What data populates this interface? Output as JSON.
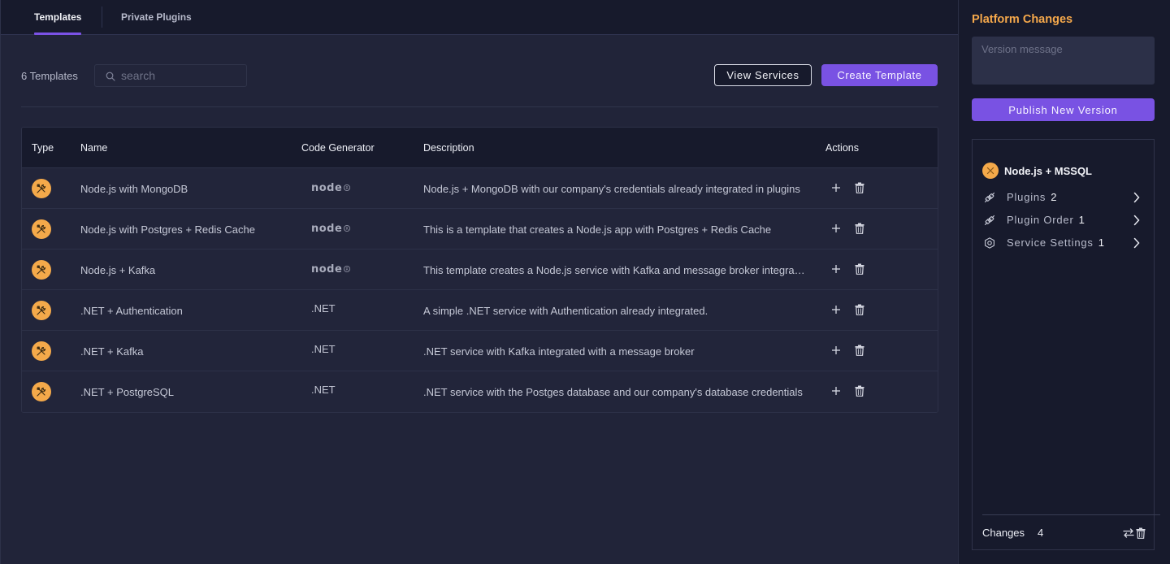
{
  "tabs": [
    {
      "label": "Templates",
      "active": true
    },
    {
      "label": "Private Plugins",
      "active": false
    }
  ],
  "toolbar": {
    "count_label": "6 Templates",
    "search_placeholder": "search",
    "search_value": "",
    "view_services_label": "View Services",
    "create_template_label": "Create Template"
  },
  "table": {
    "columns": [
      "Type",
      "Name",
      "Code Generator",
      "Description",
      "Actions"
    ],
    "rows": [
      {
        "type_icon": "tools-icon",
        "name": "Node.js with MongoDB",
        "generator": "node",
        "generator_label": "node",
        "description": "Node.js + MongoDB with our company's credentials already integrated in plugins"
      },
      {
        "type_icon": "tools-icon",
        "name": "Node.js with Postgres + Redis Cache",
        "generator": "node",
        "generator_label": "node",
        "description": "This is a template that creates a Node.js app with Postgres + Redis Cache"
      },
      {
        "type_icon": "tools-icon",
        "name": "Node.js + Kafka",
        "generator": "node",
        "generator_label": "node",
        "description": "This template creates a Node.js service with Kafka and message broker integration"
      },
      {
        "type_icon": "tools-icon",
        "name": ".NET + Authentication",
        "generator": "dotnet",
        "generator_label": ".NET",
        "description": "A simple .NET service with Authentication already integrated."
      },
      {
        "type_icon": "tools-icon",
        "name": ".NET + Kafka",
        "generator": "dotnet",
        "generator_label": ".NET",
        "description": ".NET service with Kafka integrated with a message broker"
      },
      {
        "type_icon": "tools-icon",
        "name": ".NET + PostgreSQL",
        "generator": "dotnet",
        "generator_label": ".NET",
        "description": ".NET service with the Postges database and our company's database credentials"
      }
    ]
  },
  "sidebar": {
    "title": "Platform Changes",
    "version_placeholder": "Version message",
    "version_value": "",
    "publish_label": "Publish New Version",
    "service": {
      "name": "Node.js + MSSQL",
      "items": [
        {
          "icon": "plugin-icon",
          "label": "Plugins",
          "count": "2"
        },
        {
          "icon": "plugin-icon",
          "label": "Plugin Order",
          "count": "1"
        },
        {
          "icon": "gear-icon",
          "label": "Service Settings",
          "count": "1"
        }
      ]
    },
    "changes_label": "Changes",
    "changes_count": "4"
  },
  "colors": {
    "accent": "#7952e3",
    "orange": "#f4a94a",
    "background": "#212439",
    "panel": "#171a2c"
  }
}
